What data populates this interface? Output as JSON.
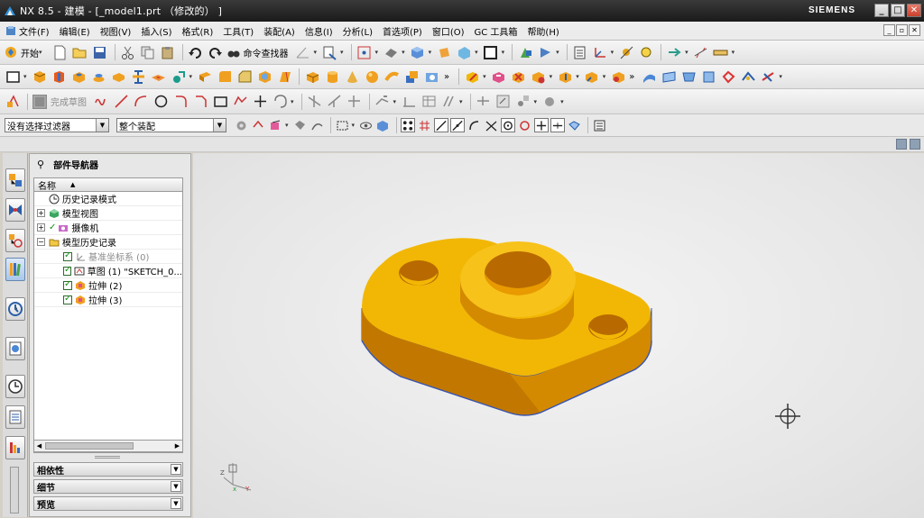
{
  "window": {
    "title": "NX 8.5 - 建模 - [_model1.prt （修改的） ]",
    "brand": "SIEMENS",
    "controls": {
      "minimize": "_",
      "maximize": "□",
      "close": "✕"
    }
  },
  "menubar": {
    "items": [
      {
        "label": "文件(F)",
        "icon": "file-menu-icon"
      },
      {
        "label": "编辑(E)"
      },
      {
        "label": "视图(V)"
      },
      {
        "label": "插入(S)"
      },
      {
        "label": "格式(R)"
      },
      {
        "label": "工具(T)"
      },
      {
        "label": "装配(A)"
      },
      {
        "label": "信息(I)"
      },
      {
        "label": "分析(L)"
      },
      {
        "label": "首选项(P)"
      },
      {
        "label": "窗口(O)"
      },
      {
        "label": "GC 工具箱"
      },
      {
        "label": "帮助(H)"
      }
    ]
  },
  "toolbar1": {
    "start_label": "开始",
    "command_finder_label": "命令查找器"
  },
  "toolbar3": {
    "finish_sketch_label": "完成草图"
  },
  "selection": {
    "filter_value": "没有选择过滤器",
    "scope_value": "整个装配"
  },
  "part_navigator": {
    "title": "部件导航器",
    "column_header": "名称",
    "rows": [
      {
        "label": "历史记录模式",
        "icon": "clock-icon"
      },
      {
        "label": "模型视图",
        "icon": "model-view-icon"
      },
      {
        "label": "摄像机",
        "icon": "camera-icon"
      },
      {
        "label": "模型历史记录",
        "icon": "folder-icon"
      },
      {
        "label": "基准坐标系 (0)",
        "icon": "datum-csys-icon"
      },
      {
        "label": "草图 (1) \"SKETCH_0...",
        "icon": "sketch-icon"
      },
      {
        "label": "拉伸 (2)",
        "icon": "extrude-icon"
      },
      {
        "label": "拉伸 (3)",
        "icon": "extrude-icon"
      }
    ],
    "sections": [
      "相依性",
      "细节",
      "预览"
    ]
  },
  "colors": {
    "part_top": "#f2b705",
    "part_side": "#d38a00",
    "part_shadow": "#b06a00",
    "viewport_bg": "#ebebeb",
    "titlebar": "#2a2a2a"
  }
}
